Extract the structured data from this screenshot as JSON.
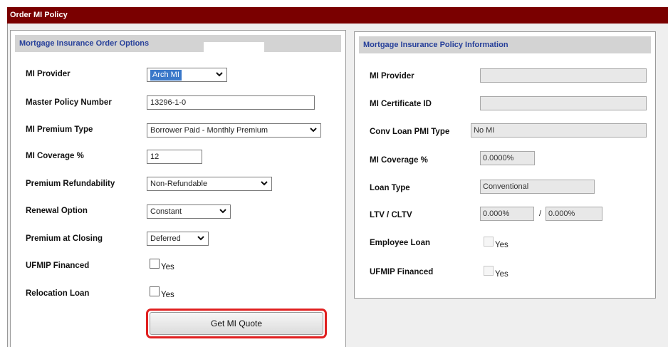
{
  "window": {
    "title": "Order MI Policy"
  },
  "order_options": {
    "header": "Mortgage Insurance Order Options",
    "mi_provider": {
      "label": "MI Provider",
      "value": "Arch MI"
    },
    "master_policy_number": {
      "label": "Master Policy Number",
      "value": "13296-1-0"
    },
    "mi_premium_type": {
      "label": "MI Premium Type",
      "value": "Borrower Paid - Monthly Premium"
    },
    "mi_coverage": {
      "label": "MI Coverage %",
      "value": "12"
    },
    "premium_refundability": {
      "label": "Premium Refundability",
      "value": "Non-Refundable"
    },
    "renewal_option": {
      "label": "Renewal Option",
      "value": "Constant"
    },
    "premium_at_closing": {
      "label": "Premium at Closing",
      "value": "Deferred"
    },
    "ufmip_financed": {
      "label": "UFMIP Financed",
      "checkbox_text": "Yes",
      "checked": false
    },
    "relocation_loan": {
      "label": "Relocation Loan",
      "checkbox_text": "Yes",
      "checked": false
    },
    "get_quote_button": "Get MI Quote"
  },
  "policy_info": {
    "header": "Mortgage Insurance Policy Information",
    "mi_provider": {
      "label": "MI Provider",
      "value": ""
    },
    "mi_certificate_id": {
      "label": "MI Certificate ID",
      "value": ""
    },
    "conv_loan_pmi_type": {
      "label": "Conv Loan PMI Type",
      "value": "No MI"
    },
    "mi_coverage": {
      "label": "MI Coverage %",
      "value": "0.0000%"
    },
    "loan_type": {
      "label": "Loan Type",
      "value": "Conventional"
    },
    "ltv_cltv": {
      "label": "LTV / CLTV",
      "ltv": "0.000%",
      "separator": "/",
      "cltv": "0.000%"
    },
    "employee_loan": {
      "label": "Employee Loan",
      "checkbox_text": "Yes",
      "checked": false
    },
    "ufmip_financed": {
      "label": "UFMIP Financed",
      "checkbox_text": "Yes",
      "checked": false
    }
  },
  "colors": {
    "title_bar": "#7a0000",
    "panel_header_text": "#27409a",
    "panel_header_bg": "#d3d3d3",
    "selected_option": "#3a78c9",
    "highlight_outline": "#e02020"
  },
  "icons": {
    "dropdown": "chevron-down-icon"
  }
}
